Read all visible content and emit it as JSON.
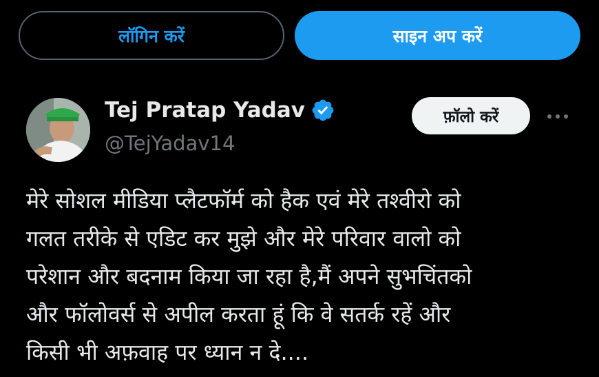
{
  "header": {
    "login_label": "लॉगिन करें",
    "signup_label": "साइन अप करें"
  },
  "tweet": {
    "author_name": "Tej Pratap Yadav",
    "author_handle": "@TejYadav14",
    "verified_icon": "verified-badge-icon",
    "follow_label": "फ़ॉलो करें",
    "more_icon": "more-options-icon",
    "text": "मेरे सोशल मीडिया प्लैटफॉर्म को हैक एवं मेरे तश्वीरो को\nगलत तरीके से एडिट कर मुझे और मेरे परिवार वालो को\nपरेशान और बदनाम किया जा रहा है,मैं अपने सुभचिंतको\nऔर फॉलोवर्स से अपील करता हूं कि वे सतर्क रहें और\nकिसी भी अफ़वाह पर ध्यान न दे...."
  },
  "colors": {
    "background": "#000000",
    "accent": "#1d9bf0",
    "text_primary": "#e7e9ea",
    "text_secondary": "#71767b",
    "follow_bg": "#eff3f4"
  }
}
